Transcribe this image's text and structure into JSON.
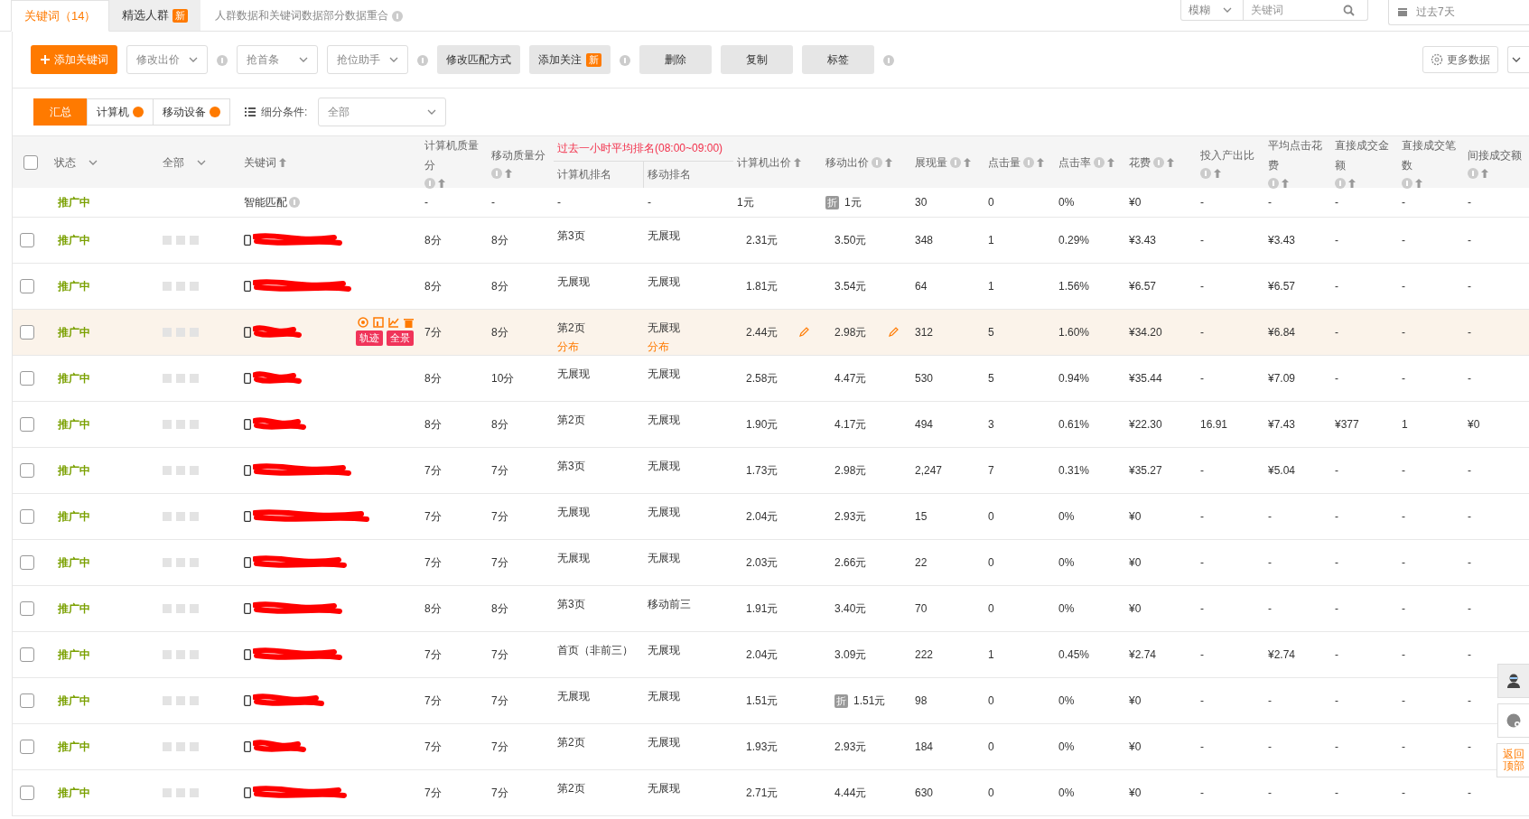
{
  "tabs": [
    {
      "label": "关键词（14）",
      "selected": true
    },
    {
      "label": "精选人群",
      "badge": "新",
      "selected": false
    }
  ],
  "tab_note": "人群数据和关键词数据部分数据重合",
  "search": {
    "mode": "模糊",
    "placeholder": "关键词"
  },
  "date_range": "过去7天",
  "toolbar": [
    {
      "kind": "primary",
      "label": "添加关键词",
      "help": false
    },
    {
      "kind": "dropdown",
      "label": "修改出价",
      "help": true
    },
    {
      "kind": "dropdown",
      "label": "抢首条",
      "help": false
    },
    {
      "kind": "dropdown",
      "label": "抢位助手",
      "help": true
    },
    {
      "kind": "gray",
      "label": "修改匹配方式",
      "help": false
    },
    {
      "kind": "gray",
      "label": "添加关注",
      "badge": "新",
      "help": true
    },
    {
      "kind": "gray",
      "label": "删除",
      "help": false
    },
    {
      "kind": "gray",
      "label": "复制",
      "help": false
    },
    {
      "kind": "gray",
      "label": "标签",
      "help": true
    }
  ],
  "more_data": "更多数据",
  "segments": [
    {
      "label": "汇总",
      "selected": true,
      "help": false
    },
    {
      "label": "计算机",
      "selected": false,
      "help": true
    },
    {
      "label": "移动设备",
      "selected": false,
      "help": true
    }
  ],
  "filter": {
    "label": "细分条件:",
    "value": "全部"
  },
  "header": {
    "select_all_checked": false,
    "status": "状态",
    "scope": "全部",
    "keyword": "关键词",
    "rank_group": "过去一小时平均排名(08:00~09:00)",
    "columns": [
      {
        "label": "计算机质量分",
        "help": true,
        "kind": "sort"
      },
      {
        "label": "移动质量分",
        "help": true,
        "kind": "sort"
      },
      {
        "label": "计算机排名",
        "kind": "sub"
      },
      {
        "label": "移动排名",
        "kind": "sub"
      },
      {
        "label": "计算机出价",
        "help": false,
        "kind": "sort"
      },
      {
        "label": "移动出价",
        "help": true,
        "kind": "sort"
      },
      {
        "label": "展现量",
        "help": true,
        "kind": "sort"
      },
      {
        "label": "点击量",
        "help": true,
        "kind": "sort"
      },
      {
        "label": "点击率",
        "help": true,
        "kind": "sort"
      },
      {
        "label": "花费",
        "help": true,
        "kind": "sort"
      },
      {
        "label": "投入产出比",
        "help": true,
        "kind": "sort"
      },
      {
        "label": "平均点击花费",
        "help": true,
        "kind": "sort"
      },
      {
        "label": "直接成交金额",
        "help": true,
        "kind": "sort"
      },
      {
        "label": "直接成交笔数",
        "help": true,
        "kind": "sort"
      },
      {
        "label": "间接成交额",
        "help": true,
        "kind": "sort"
      }
    ]
  },
  "rows": [
    {
      "kind": "smart",
      "status": "推广中",
      "keyword": "智能匹配",
      "highlighted": false,
      "m_bid_badge": "折",
      "cells": [
        "-",
        "-",
        "-",
        "-",
        "1元",
        "1元",
        "30",
        "0",
        "0%",
        "¥0",
        "-",
        "-",
        "-",
        "-",
        "-"
      ]
    },
    {
      "kind": "keyword",
      "checked": false,
      "status": "推广中",
      "highlighted": false,
      "cells": [
        "8分",
        "8分",
        "第3页",
        "无展现",
        "2.31元",
        "3.50元",
        "348",
        "1",
        "0.29%",
        "¥3.43",
        "-",
        "¥3.43",
        "-",
        "-",
        "-"
      ]
    },
    {
      "kind": "keyword",
      "checked": false,
      "status": "推广中",
      "highlighted": false,
      "cells": [
        "8分",
        "8分",
        "无展现",
        "无展现",
        "1.81元",
        "3.54元",
        "64",
        "1",
        "1.56%",
        "¥6.57",
        "-",
        "¥6.57",
        "-",
        "-",
        "-"
      ]
    },
    {
      "kind": "keyword",
      "checked": false,
      "status": "推广中",
      "highlighted": true,
      "rank_links": [
        "分布",
        "分布"
      ],
      "tags": [
        "轨迹",
        "全景"
      ],
      "cells": [
        "7分",
        "8分",
        "第2页",
        "无展现",
        "2.44元",
        "2.98元",
        "312",
        "5",
        "1.60%",
        "¥34.20",
        "-",
        "¥6.84",
        "-",
        "-",
        "-"
      ]
    },
    {
      "kind": "keyword",
      "checked": false,
      "status": "推广中",
      "highlighted": false,
      "cells": [
        "8分",
        "10分",
        "无展现",
        "无展现",
        "2.58元",
        "4.47元",
        "530",
        "5",
        "0.94%",
        "¥35.44",
        "-",
        "¥7.09",
        "-",
        "-",
        "-"
      ]
    },
    {
      "kind": "keyword",
      "checked": false,
      "status": "推广中",
      "highlighted": false,
      "cells": [
        "8分",
        "8分",
        "第2页",
        "无展现",
        "1.90元",
        "4.17元",
        "494",
        "3",
        "0.61%",
        "¥22.30",
        "16.91",
        "¥7.43",
        "¥377",
        "1",
        "¥0"
      ]
    },
    {
      "kind": "keyword",
      "checked": false,
      "status": "推广中",
      "highlighted": false,
      "cells": [
        "7分",
        "7分",
        "第3页",
        "无展现",
        "1.73元",
        "2.98元",
        "2,247",
        "7",
        "0.31%",
        "¥35.27",
        "-",
        "¥5.04",
        "-",
        "-",
        "-"
      ]
    },
    {
      "kind": "keyword",
      "checked": false,
      "status": "推广中",
      "highlighted": false,
      "cells": [
        "7分",
        "7分",
        "无展现",
        "无展现",
        "2.04元",
        "2.93元",
        "15",
        "0",
        "0%",
        "¥0",
        "-",
        "-",
        "-",
        "-",
        "-"
      ]
    },
    {
      "kind": "keyword",
      "checked": false,
      "status": "推广中",
      "highlighted": false,
      "cells": [
        "7分",
        "7分",
        "无展现",
        "无展现",
        "2.03元",
        "2.66元",
        "22",
        "0",
        "0%",
        "¥0",
        "-",
        "-",
        "-",
        "-",
        "-"
      ]
    },
    {
      "kind": "keyword",
      "checked": false,
      "status": "推广中",
      "highlighted": false,
      "cells": [
        "8分",
        "8分",
        "第3页",
        "移动前三",
        "1.91元",
        "3.40元",
        "70",
        "0",
        "0%",
        "¥0",
        "-",
        "-",
        "-",
        "-",
        "-"
      ]
    },
    {
      "kind": "keyword",
      "checked": false,
      "status": "推广中",
      "highlighted": false,
      "cells": [
        "7分",
        "7分",
        "首页（非前三）",
        "无展现",
        "2.04元",
        "3.09元",
        "222",
        "1",
        "0.45%",
        "¥2.74",
        "-",
        "¥2.74",
        "-",
        "-",
        "-"
      ]
    },
    {
      "kind": "keyword",
      "checked": false,
      "status": "推广中",
      "highlighted": false,
      "m_bid_badge": "折",
      "cells": [
        "7分",
        "7分",
        "无展现",
        "无展现",
        "1.51元",
        "1.51元",
        "98",
        "0",
        "0%",
        "¥0",
        "-",
        "-",
        "-",
        "-",
        "-"
      ]
    },
    {
      "kind": "keyword",
      "checked": false,
      "status": "推广中",
      "highlighted": false,
      "cells": [
        "7分",
        "7分",
        "第2页",
        "无展现",
        "1.93元",
        "2.93元",
        "184",
        "0",
        "0%",
        "¥0",
        "-",
        "-",
        "-",
        "-",
        "-"
      ]
    },
    {
      "kind": "keyword",
      "checked": false,
      "status": "推广中",
      "highlighted": false,
      "cells": [
        "7分",
        "7分",
        "第2页",
        "无展现",
        "2.71元",
        "4.44元",
        "630",
        "0",
        "0%",
        "¥0",
        "-",
        "-",
        "-",
        "-",
        "-"
      ]
    }
  ],
  "back_to_top": "返回顶部"
}
